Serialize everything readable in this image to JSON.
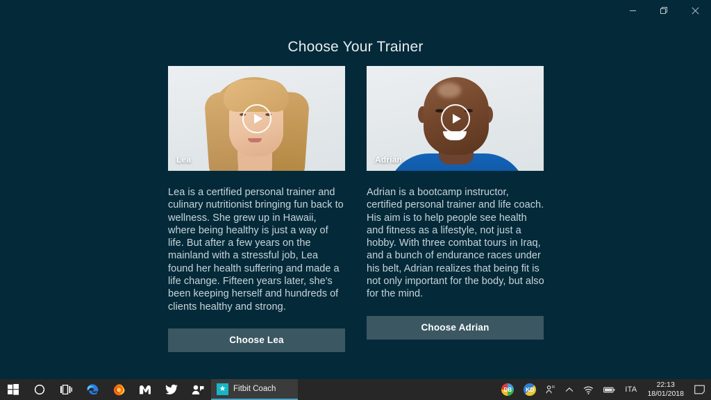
{
  "window": {
    "controls": [
      {
        "name": "minimize",
        "label": "Minimize"
      },
      {
        "name": "restore",
        "label": "Restore"
      },
      {
        "name": "close",
        "label": "Close"
      }
    ],
    "background_color": "#042a3a"
  },
  "page": {
    "title": "Choose Your Trainer"
  },
  "trainers": [
    {
      "name": "Lea",
      "media_label": "Lea",
      "description": "Lea is a certified personal trainer and culinary nutritionist bringing fun back to wellness. She grew up in Hawaii, where being healthy is just a way of life. But after a few years on the mainland with a stressful job, Lea found her health suffering and made a life change. Fifteen years later, she's been keeping herself and hundreds of clients healthy and strong.",
      "button_label": "Choose Lea"
    },
    {
      "name": "Adrian",
      "media_label": "Adrian",
      "description": "Adrian is a bootcamp instructor, certified personal trainer and life coach. His aim is to help people see health and fitness as a lifestyle, not just a hobby. With three combat tours in Iraq, and a bunch of endurance races under his belt, Adrian realizes that being fit is not only important for the body, but also for the mind.",
      "button_label": "Choose Adrian"
    }
  ],
  "colors": {
    "app_background": "#042a3a",
    "button_fill": "#3a5762",
    "body_text": "#c8d4d9",
    "title_text": "#e7ecee",
    "taskbar": "#272727",
    "accent": "#17b6c4"
  },
  "taskbar": {
    "items": [
      {
        "name": "start",
        "label": "Start"
      },
      {
        "name": "cortana",
        "label": "Cortana"
      },
      {
        "name": "task-view",
        "label": "Task View"
      },
      {
        "name": "edge",
        "label": "Microsoft Edge"
      },
      {
        "name": "firefox",
        "label": "Firefox"
      },
      {
        "name": "app-m",
        "label": "M"
      },
      {
        "name": "twitter",
        "label": "Twitter"
      },
      {
        "name": "people",
        "label": "People"
      }
    ],
    "active_app": {
      "label": "Fitbit Coach",
      "icon": "star-icon"
    },
    "tray": {
      "db_icon_label": "DB",
      "kd_icon_label": "KD",
      "icons": [
        {
          "name": "remote-person-icon",
          "label": "Remote access"
        },
        {
          "name": "chevron-up-icon",
          "label": "Show hidden icons"
        },
        {
          "name": "wifi-icon",
          "label": "Network"
        },
        {
          "name": "battery-icon",
          "label": "Battery"
        }
      ],
      "language": "ITA",
      "time": "22:13",
      "date": "18/01/2018",
      "action_center": "Action Center"
    }
  }
}
